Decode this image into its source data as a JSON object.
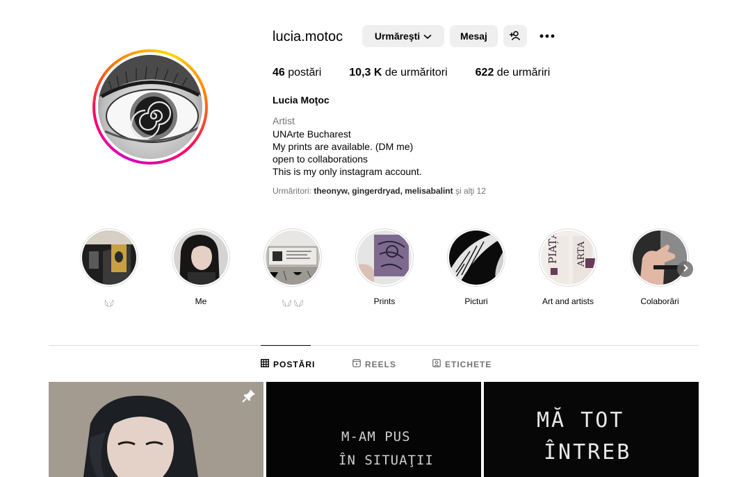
{
  "profile": {
    "username": "lucia.motoc",
    "full_name": "Lucia Moţoc",
    "category": "Artist",
    "bio_lines": [
      "UNArte Bucharest",
      "My prints are available. (DM me)",
      "open to collaborations",
      "This is my only instagram account."
    ],
    "followed_by_label": "Urmăritori: ",
    "followed_by_names": "theonyw, gingerdryad, melisabalint",
    "followed_by_suffix": " şi alţi 12"
  },
  "actions": {
    "follow_label": "Urmăreşti",
    "message_label": "Mesaj",
    "suggest_icon": "person-add-icon",
    "more_icon": "more-horizontal-icon"
  },
  "stats": [
    {
      "count": "46",
      "label": " postări"
    },
    {
      "count": "10,3 K",
      "label": " de urmăritori"
    },
    {
      "count": "622",
      "label": " de urmăriri"
    }
  ],
  "highlights": [
    {
      "label": "𓆩𓆪"
    },
    {
      "label": "Me"
    },
    {
      "label": "𓆩𓆪 𓆩𓆪"
    },
    {
      "label": "Prints"
    },
    {
      "label": "Picturi"
    },
    {
      "label": "Art and artists"
    },
    {
      "label": "Colaborări"
    }
  ],
  "tabs": [
    {
      "label": "POSTĂRI",
      "icon": "grid-icon",
      "active": true
    },
    {
      "label": "REELS",
      "icon": "reels-icon",
      "active": false
    },
    {
      "label": "ETICHETE",
      "icon": "tagged-icon",
      "active": false
    }
  ],
  "posts": {
    "post_2_text": [
      "M-AM PUS",
      "ÎN SITUAŢII"
    ],
    "post_3_text": [
      "MĂ TOT",
      "ÎNTREB"
    ]
  },
  "colors": {
    "ring_gradient": [
      "#d300c5",
      "#ff0069",
      "#ff7a00",
      "#ffd600"
    ],
    "button_bg": "#efefef",
    "muted_text": "#737373"
  }
}
